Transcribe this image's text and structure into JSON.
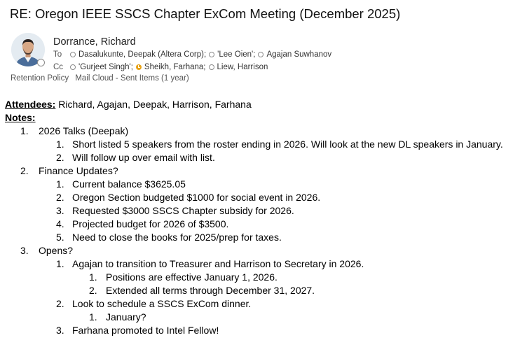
{
  "email": {
    "subject": "RE: Oregon IEEE SSCS Chapter ExCom Meeting (December 2025)",
    "sender": "Dorrance, Richard",
    "to_label": "To",
    "cc_label": "Cc",
    "to": [
      {
        "name": "Dasalukunte, Deepak  (Altera Corp);",
        "presence": "offline"
      },
      {
        "name": "'Lee Oien';",
        "presence": "offline"
      },
      {
        "name": "Agajan Suwhanov",
        "presence": "offline"
      }
    ],
    "cc": [
      {
        "name": "'Gurjeet Singh';",
        "presence": "offline"
      },
      {
        "name": "Sheikh, Farhana;",
        "presence": "away"
      },
      {
        "name": "Liew, Harrison",
        "presence": "offline"
      }
    ],
    "retention_policy": "Retention Policy",
    "retention_value": "Mail Cloud - Sent Items (1 year)",
    "colors": {
      "away": "#e8a317",
      "presence_border": "#8a8a8a"
    }
  },
  "body": {
    "attendees_label": "Attendees:",
    "attendees": " Richard, Agajan, Deepak, Harrison, Farhana",
    "notes_label": "Notes:",
    "items": [
      {
        "n": "1.",
        "text": "2026 Talks (Deepak)",
        "sub": [
          {
            "n": "1.",
            "text": "Short listed 5 speakers from the roster ending in 2026. Will look at the new DL speakers in January."
          },
          {
            "n": "2.",
            "text": "Will follow up over email with list."
          }
        ]
      },
      {
        "n": "2.",
        "text": "Finance Updates?",
        "sub": [
          {
            "n": "1.",
            "text": "Current balance $3625.05"
          },
          {
            "n": "2.",
            "text": "Oregon Section budgeted $1000 for social event in 2026."
          },
          {
            "n": "3.",
            "text": "Requested $3000 SSCS Chapter subsidy for 2026."
          },
          {
            "n": "4.",
            "text": "Projected budget for 2026 of $3500."
          },
          {
            "n": "5.",
            "text": "Need to close the books for 2025/prep for taxes."
          }
        ]
      },
      {
        "n": "3.",
        "text": "Opens?",
        "sub": [
          {
            "n": "1.",
            "text": "Agajan to transition to Treasurer and Harrison to Secretary in 2026.",
            "sub": [
              {
                "n": "1.",
                "text": "Positions are effective January 1, 2026."
              },
              {
                "n": "2.",
                "text": "Extended all terms through December 31, 2027."
              }
            ]
          },
          {
            "n": "2.",
            "text": "Look to schedule a SSCS ExCom dinner.",
            "sub": [
              {
                "n": "1.",
                "text": "January?"
              }
            ]
          },
          {
            "n": "3.",
            "text": "Farhana promoted to Intel Fellow!"
          }
        ]
      }
    ]
  }
}
